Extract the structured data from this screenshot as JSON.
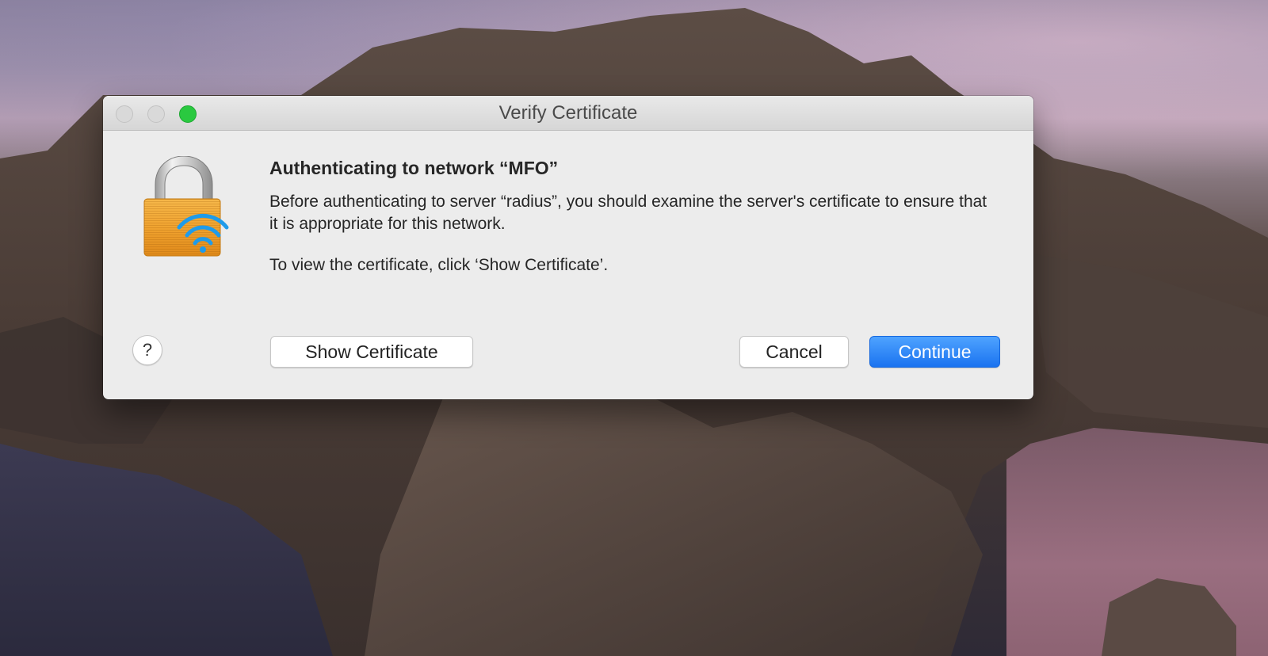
{
  "window": {
    "title": "Verify Certificate"
  },
  "dialog": {
    "heading": "Authenticating to network “MFO”",
    "description": "Before authenticating to server “radius”, you should examine the server's certificate to ensure that it is appropriate for this network.",
    "hint": "To view the certificate, click ‘Show Certificate’."
  },
  "buttons": {
    "help": "?",
    "show_certificate": "Show Certificate",
    "cancel": "Cancel",
    "continue": "Continue"
  },
  "icons": {
    "dialog_icon": "lock-wifi-icon"
  },
  "colors": {
    "accent": "#1a73f0",
    "zoom_button": "#2ac940",
    "lock_body": "#f0a330"
  }
}
